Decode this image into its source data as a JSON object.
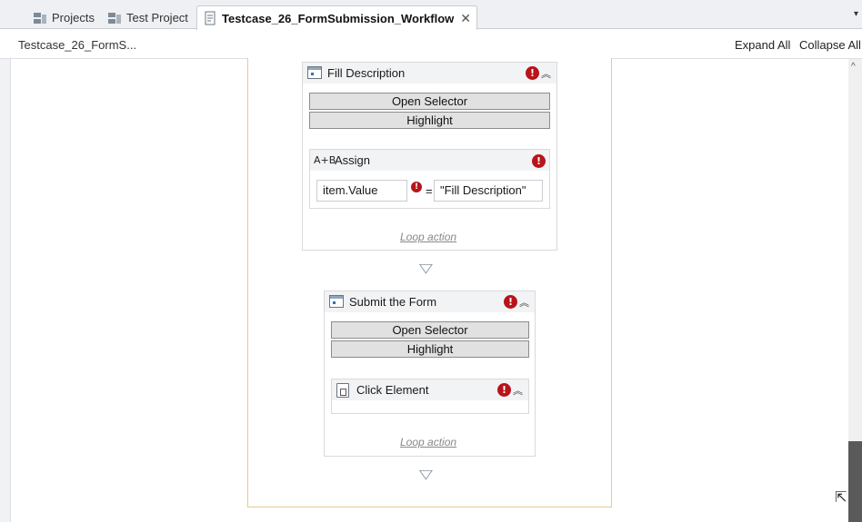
{
  "tabs": [
    {
      "label": "Projects",
      "icon": "projects-icon"
    },
    {
      "label": "Test Project",
      "icon": "test-project-icon"
    },
    {
      "label": "Testcase_26_FormSubmission_Workflow",
      "icon": "testcase-file-icon",
      "active": true
    }
  ],
  "tab_close_glyph": "✕",
  "tab_menu_glyph": "▾",
  "pathbar": {
    "breadcrumb": "Testcase_26_FormS...",
    "expand_all": "Expand All",
    "collapse_all": "Collapse All"
  },
  "fill_description": {
    "title": "Fill Description",
    "open_selector": "Open Selector",
    "highlight": "Highlight",
    "assign": {
      "title": "Assign",
      "left_value": "item.Value",
      "equals": "=",
      "right_value": "\"Fill Description\""
    },
    "loop_action": "Loop action"
  },
  "submit_form": {
    "title": "Submit the Form",
    "open_selector": "Open Selector",
    "highlight": "Highlight",
    "click_element": {
      "title": "Click Element"
    },
    "loop_action": "Loop action"
  },
  "glyphs": {
    "error": "!",
    "collapse_chevron": "︽",
    "flow_arrow": "▽",
    "scroll_up": "^",
    "assign_icon": "A+B"
  },
  "colors": {
    "error_red": "#b8141b",
    "outer_border": "#e8c98a",
    "button_bg": "#e1e1e1"
  }
}
